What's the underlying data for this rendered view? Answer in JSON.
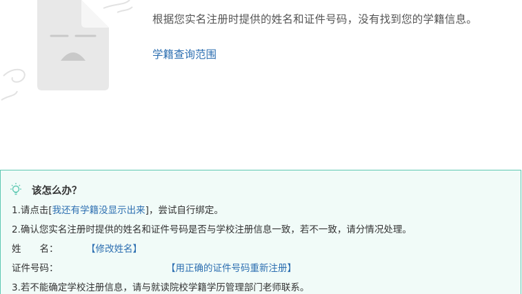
{
  "result": {
    "message": "根据您实名注册时提供的姓名和证件号码，没有找到您的学籍信息。",
    "scope_link": "学籍查询范围"
  },
  "help": {
    "title": "该怎么办？",
    "step1_prefix": "1.请点击[",
    "step1_link": "我还有学籍没显示出来",
    "step1_suffix": "]，尝试自行绑定。",
    "step2": "2.确认您实名注册时提供的姓名和证件号码是否与学校注册信息一致，若不一致，请分情况处理。",
    "name_label": "姓　　名：",
    "name_fix_link": "【修改姓名】",
    "id_label": "证件号码：",
    "id_fix_link": "【用正确的证件号码重新注册】",
    "step3": "3.若不能确定学校注册信息，请与就读院校学籍学历管理部门老师联系。"
  },
  "colors": {
    "link": "#2d6fb1",
    "panel_bg": "#f1fbf8",
    "panel_border": "#5cc8b1"
  }
}
